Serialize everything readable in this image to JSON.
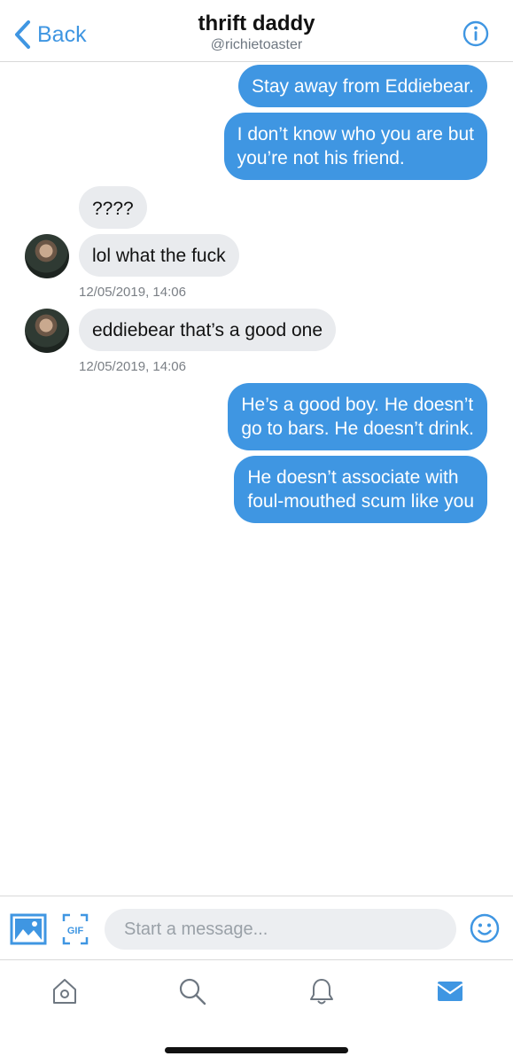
{
  "header": {
    "back_label": "Back",
    "title": "thrift daddy",
    "handle": "@richietoaster"
  },
  "messages": [
    {
      "direction": "outgoing",
      "lines": [
        "Stay away from Eddiebear."
      ]
    },
    {
      "direction": "outgoing",
      "lines": [
        "I don’t know who you are but",
        "you’re not his friend."
      ]
    },
    {
      "direction": "incoming",
      "lines": [
        "????"
      ]
    },
    {
      "direction": "incoming",
      "lines": [
        "lol what the fuck"
      ],
      "timestamp": "12/05/2019, 14:06"
    },
    {
      "direction": "incoming",
      "lines": [
        "eddiebear that’s a good one"
      ],
      "timestamp": "12/05/2019, 14:06"
    },
    {
      "direction": "outgoing",
      "lines": [
        "He’s a good boy. He doesn’t",
        "go to bars. He doesn’t drink."
      ]
    },
    {
      "direction": "outgoing",
      "lines": [
        "He doesn’t associate with",
        "foul-mouthed scum like you"
      ]
    }
  ],
  "composer": {
    "placeholder": "Start a message...",
    "gif_label": "GIF"
  },
  "icons": {
    "back": "chevron-left-icon",
    "info": "info-icon",
    "media": "image-icon",
    "gif": "gif-icon",
    "emoji": "emoji-icon",
    "home": "home-icon",
    "search": "search-icon",
    "notifications": "bell-icon",
    "messages": "envelope-icon"
  },
  "colors": {
    "accent": "#3f96e2",
    "incoming_bubble": "#e9ebee",
    "outgoing_bubble": "#3f96e2"
  }
}
